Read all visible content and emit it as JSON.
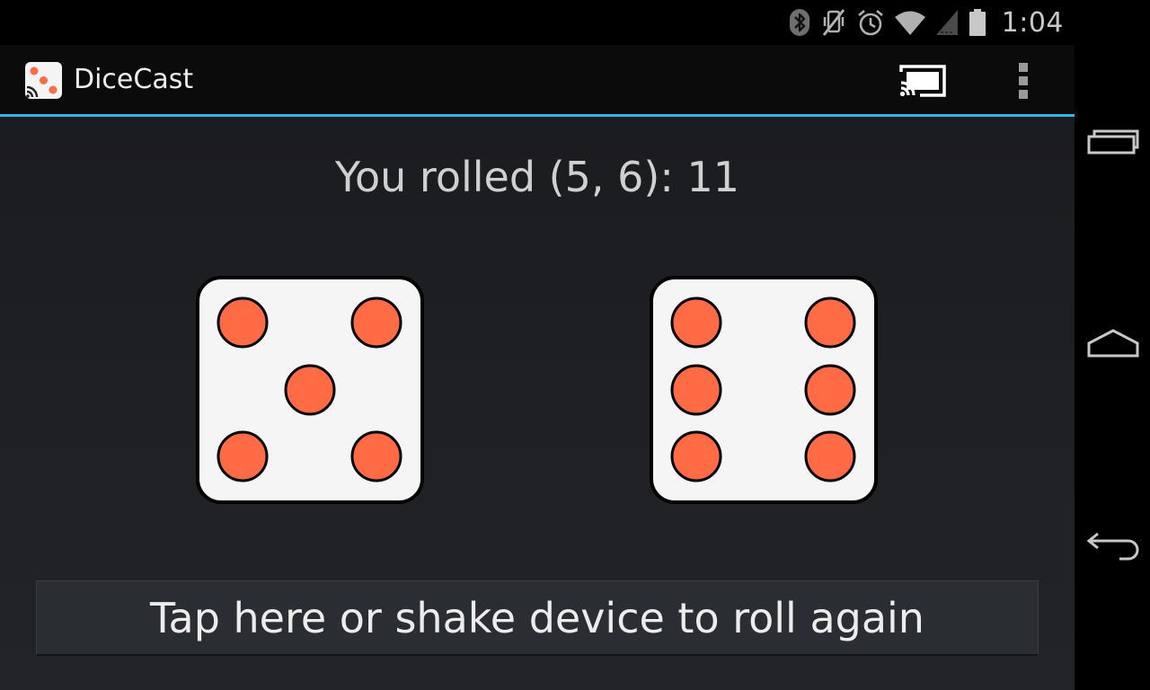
{
  "status_bar": {
    "time": "1:04",
    "icons": [
      "bluetooth-icon",
      "vibrate-mute-icon",
      "alarm-icon",
      "wifi-icon",
      "signal-icon",
      "battery-icon"
    ]
  },
  "action_bar": {
    "title": "DiceCast",
    "icons": [
      "app-logo-icon",
      "cast-icon",
      "overflow-menu-icon"
    ],
    "accent_color": "#33b5e5"
  },
  "main": {
    "result_text": "You rolled (5, 6): 11",
    "dice": [
      {
        "value": 5
      },
      {
        "value": 6
      }
    ],
    "pip_color": "#ff6b45",
    "roll_button_label": "Tap here or shake device to roll again"
  },
  "nav_bar": {
    "icons": [
      "recent-apps-icon",
      "home-icon",
      "back-icon"
    ]
  }
}
